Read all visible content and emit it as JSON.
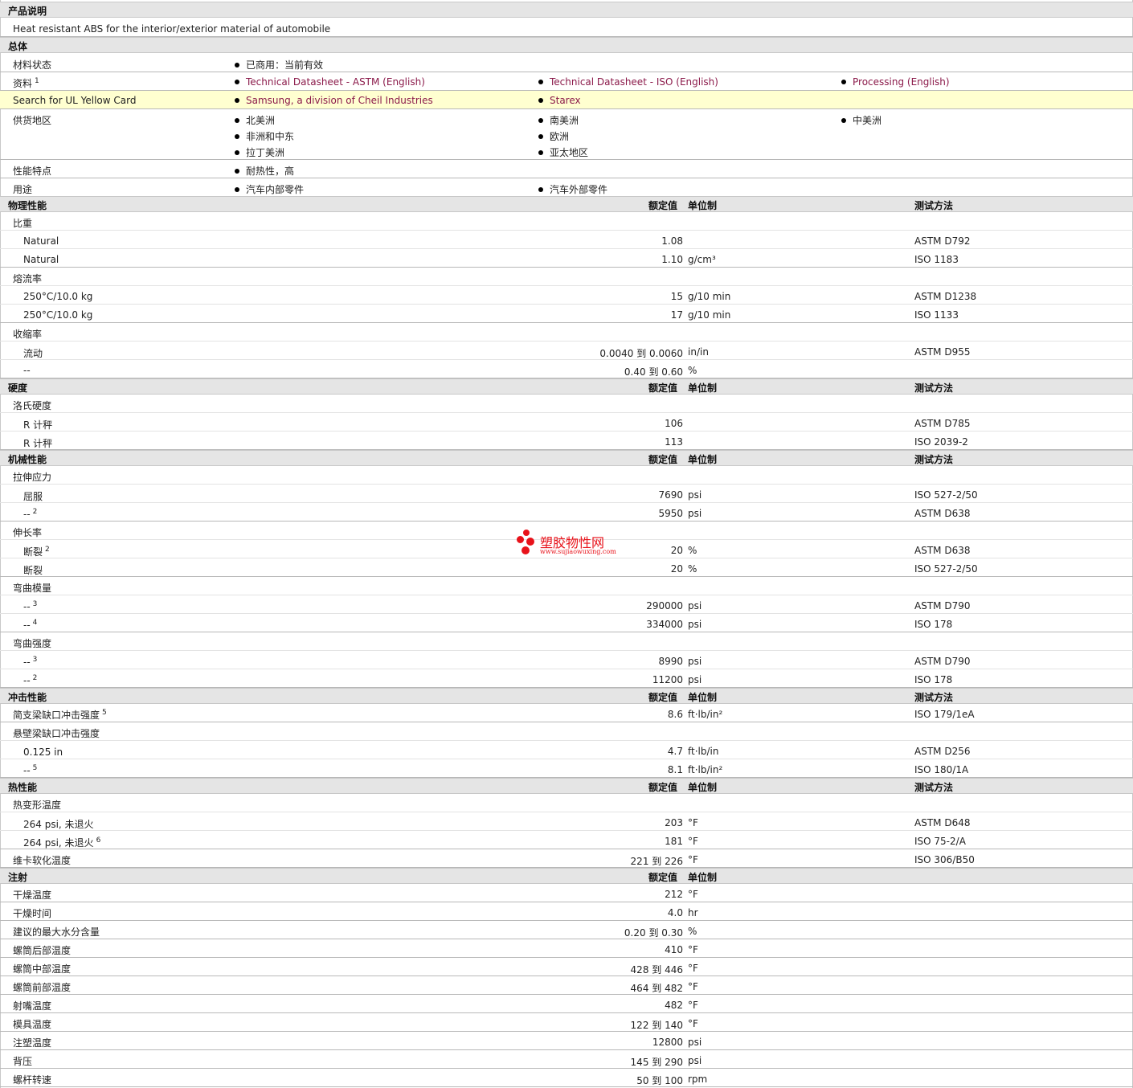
{
  "section_product": {
    "title": "产品说明",
    "text": "Heat resistant ABS for the interior/exterior material of automobile"
  },
  "section_general": {
    "title": "总体",
    "status_label": "材料状态",
    "status_value": "已商用：当前有效",
    "docs_label": "资料",
    "docs_sup": "1",
    "docs": [
      "Technical Datasheet - ASTM (English)",
      "Technical Datasheet - ISO (English)",
      "Processing (English)"
    ],
    "ul_label": "Search for UL Yellow Card",
    "ul_links": [
      "Samsung, a division of Cheil Industries",
      "Starex"
    ],
    "supply_label": "供货地区",
    "supply_col1": [
      "北美洲",
      "非洲和中东",
      "拉丁美洲"
    ],
    "supply_col2": [
      "南美洲",
      "欧洲",
      "亚太地区"
    ],
    "supply_col3": [
      "中美洲"
    ],
    "features_label": "性能特点",
    "features_value": "耐热性，高",
    "uses_label": "用途",
    "uses_values": [
      "汽车内部零件",
      "汽车外部零件"
    ]
  },
  "columns": {
    "nominal": "额定值",
    "unit": "单位制",
    "method": "测试方法"
  },
  "physical": {
    "title": "物理性能",
    "specific_gravity": "比重",
    "sg_rows": [
      {
        "cond": "Natural",
        "val": "1.08",
        "unit": "",
        "method": "ASTM D792"
      },
      {
        "cond": "Natural",
        "val": "1.10",
        "unit": "g/cm³",
        "method": "ISO 1183"
      }
    ],
    "melt_flow": "熔流率",
    "mf_rows": [
      {
        "cond": "250°C/10.0 kg",
        "val": "15",
        "unit": "g/10 min",
        "method": "ASTM D1238"
      },
      {
        "cond": "250°C/10.0 kg",
        "val": "17",
        "unit": "g/10 min",
        "method": "ISO 1133"
      }
    ],
    "shrinkage": "收缩率",
    "sh_rows": [
      {
        "cond": "流动",
        "val": "0.0040 到  0.0060",
        "unit": "in/in",
        "method": "ASTM D955"
      },
      {
        "cond": "--",
        "val": "0.40 到  0.60",
        "unit": "%",
        "method": ""
      }
    ]
  },
  "hardness": {
    "title": "硬度",
    "rockwell": "洛氏硬度",
    "rows": [
      {
        "cond": "R 计秤",
        "val": "106",
        "unit": "",
        "method": "ASTM D785"
      },
      {
        "cond": "R 计秤",
        "val": "113",
        "unit": "",
        "method": "ISO 2039-2"
      }
    ]
  },
  "mechanical": {
    "title": "机械性能",
    "tensile": "拉伸应力",
    "tensile_rows": [
      {
        "cond": "屈服",
        "sup": "",
        "val": "7690",
        "unit": "psi",
        "method": "ISO 527-2/50"
      },
      {
        "cond": "--",
        "sup": "2",
        "val": "5950",
        "unit": "psi",
        "method": "ASTM D638"
      }
    ],
    "elongation": "伸长率",
    "elong_rows": [
      {
        "cond": "断裂",
        "sup": "2",
        "val": "20",
        "unit": "%",
        "method": "ASTM D638"
      },
      {
        "cond": "断裂",
        "sup": "",
        "val": "20",
        "unit": "%",
        "method": "ISO 527-2/50"
      }
    ],
    "flex_modulus": "弯曲模量",
    "fm_rows": [
      {
        "cond": "--",
        "sup": "3",
        "val": "290000",
        "unit": "psi",
        "method": "ASTM D790"
      },
      {
        "cond": "--",
        "sup": "4",
        "val": "334000",
        "unit": "psi",
        "method": "ISO 178"
      }
    ],
    "flex_strength": "弯曲强度",
    "fs_rows": [
      {
        "cond": "--",
        "sup": "3",
        "val": "8990",
        "unit": "psi",
        "method": "ASTM D790"
      },
      {
        "cond": "--",
        "sup": "2",
        "val": "11200",
        "unit": "psi",
        "method": "ISO 178"
      }
    ]
  },
  "impact": {
    "title": "冲击性能",
    "charpy": "简支梁缺口冲击强度",
    "charpy_sup": "5",
    "charpy_val": "8.6",
    "charpy_unit": "ft·lb/in²",
    "charpy_method": "ISO 179/1eA",
    "izod": "悬壁梁缺口冲击强度",
    "izod_rows": [
      {
        "cond": "0.125 in",
        "sup": "",
        "val": "4.7",
        "unit": "ft·lb/in",
        "method": "ASTM D256"
      },
      {
        "cond": "--",
        "sup": "5",
        "val": "8.1",
        "unit": "ft·lb/in²",
        "method": "ISO 180/1A"
      }
    ]
  },
  "thermal": {
    "title": "热性能",
    "hdt": "热变形温度",
    "hdt_rows": [
      {
        "cond": "264 psi, 未退火",
        "sup": "",
        "val": "203",
        "unit": "°F",
        "method": "ASTM D648"
      },
      {
        "cond": "264 psi, 未退火",
        "sup": "6",
        "val": "181",
        "unit": "°F",
        "method": "ISO 75-2/A"
      }
    ],
    "vicat": "维卡软化温度",
    "vicat_val": "221 到  226",
    "vicat_unit": "°F",
    "vicat_method": "ISO 306/B50"
  },
  "injection": {
    "title": "注射",
    "rows": [
      {
        "label": "干燥温度",
        "val": "212",
        "unit": "°F"
      },
      {
        "label": "干燥时间",
        "val": "4.0",
        "unit": "hr"
      },
      {
        "label": "建议的最大水分含量",
        "val": "0.20 到  0.30",
        "unit": "%"
      },
      {
        "label": "螺筒后部温度",
        "val": "410",
        "unit": "°F"
      },
      {
        "label": "螺筒中部温度",
        "val": "428 到  446",
        "unit": "°F"
      },
      {
        "label": "螺筒前部温度",
        "val": "464 到  482",
        "unit": "°F"
      },
      {
        "label": "射嘴温度",
        "val": "482",
        "unit": "°F"
      },
      {
        "label": "模具温度",
        "val": "122 到  140",
        "unit": "°F"
      },
      {
        "label": "注塑温度",
        "val": "12800",
        "unit": "psi"
      },
      {
        "label": "背压",
        "val": "145 到  290",
        "unit": "psi"
      },
      {
        "label": "螺杆转速",
        "val": "50 到  100",
        "unit": "rpm"
      }
    ]
  },
  "watermark": {
    "name": "塑胶物性网",
    "url": "www.sujiaowuxing.com"
  },
  "colors": {
    "link": "#8b1a4a",
    "header_bg": "#e5e5e5",
    "ul_bg": "#ffffd0",
    "watermark": "#e8121a"
  }
}
